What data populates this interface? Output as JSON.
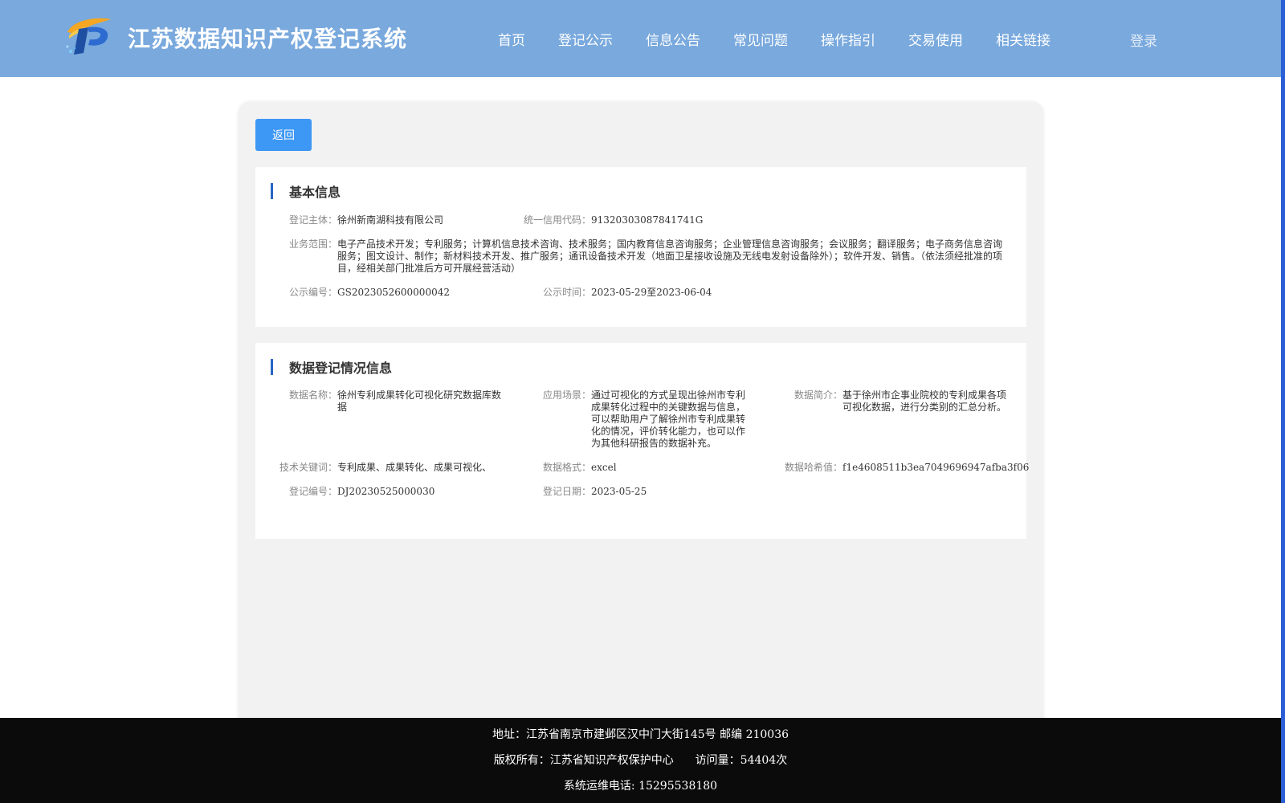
{
  "header": {
    "title": "江苏数据知识产权登记系统",
    "logo_icon": "ip-logo-icon",
    "nav": [
      "首页",
      "登记公示",
      "信息公告",
      "常见问题",
      "操作指引",
      "交易使用",
      "相关链接"
    ],
    "login": "登录",
    "background_color": "#79a9dd"
  },
  "actions": {
    "back_label": "返回",
    "back_color": "#3d97f4"
  },
  "basic": {
    "title": "基本信息",
    "subject_label": "登记主体：",
    "subject": "徐州新南湖科技有限公司",
    "credit_label": "统一信用代码：",
    "credit": "91320303087841741G",
    "scope_label": "业务范围：",
    "scope": "电子产品技术开发；专利服务；计算机信息技术咨询、技术服务；国内教育信息咨询服务；企业管理信息咨询服务；会议服务；翻译服务；电子商务信息咨询服务；图文设计、制作；新材料技术开发、推广服务；通讯设备技术开发（地面卫星接收设施及无线电发射设备除外）；软件开发、销售。（依法须经批准的项目，经相关部门批准后方可开展经营活动）",
    "notice_no_label": "公示编号：",
    "notice_no": "GS2023052600000042",
    "notice_time_label": "公示时间：",
    "notice_time": "2023-05-29至2023-06-04"
  },
  "registration": {
    "title": "数据登记情况信息",
    "name_label": "数据名称：",
    "name": "徐州专利成果转化可视化研究数据库数据",
    "scene_label": "应用场景：",
    "scene": "通过可视化的方式呈现出徐州市专利成果转化过程中的关键数据与信息，可以帮助用户了解徐州市专利成果转化的情况，评价转化能力，也可以作为其他科研报告的数据补充。",
    "intro_label": "数据简介：",
    "intro": "基于徐州市企事业院校的专利成果各项可视化数据，进行分类别的汇总分析。",
    "keywords_label": "技术关键词：",
    "keywords": "专利成果、成果转化、成果可视化、",
    "format_label": "数据格式：",
    "format": "excel",
    "hash_label": "数据哈希值：",
    "hash": "f1e4608511b3ea7049696947afba3f06",
    "reg_no_label": "登记编号：",
    "reg_no": "DJ20230525000030",
    "reg_date_label": "登记日期：",
    "reg_date": "2023-05-25"
  },
  "footer": {
    "address": "地址：江苏省南京市建邺区汉中门大街145号 邮编 210036",
    "copyright": "版权所有：江苏省知识产权保护中心",
    "visits": "访问量：54404次",
    "hotline": "系统运维电话: 15295538180"
  }
}
